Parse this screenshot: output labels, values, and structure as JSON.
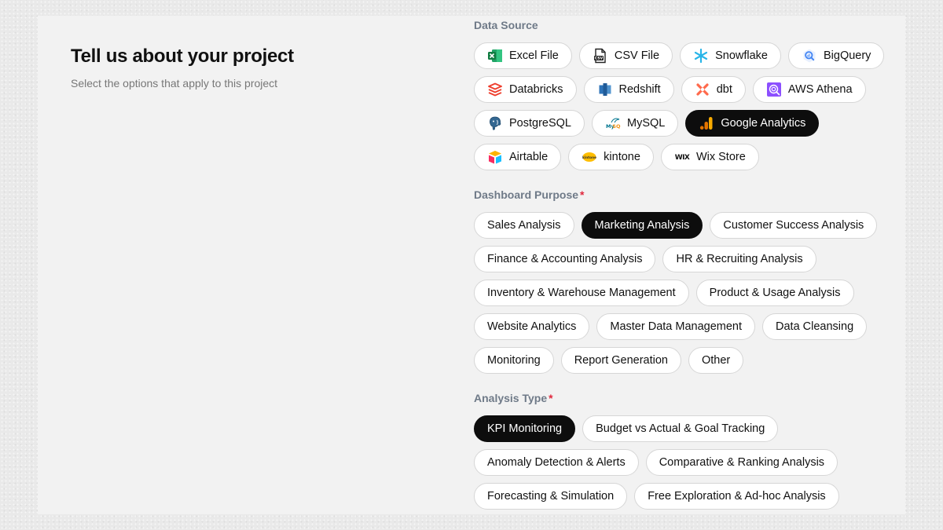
{
  "page": {
    "title": "Tell us about your project",
    "subtitle": "Select the options that apply to this project"
  },
  "sections": {
    "data_source": {
      "label": "Data Source",
      "options": [
        {
          "label": "Excel File",
          "icon": "excel-icon",
          "selected": false
        },
        {
          "label": "CSV File",
          "icon": "csv-file-icon",
          "selected": false
        },
        {
          "label": "Snowflake",
          "icon": "snowflake-icon",
          "selected": false
        },
        {
          "label": "BigQuery",
          "icon": "bigquery-icon",
          "selected": false
        },
        {
          "label": "Databricks",
          "icon": "databricks-icon",
          "selected": false
        },
        {
          "label": "Redshift",
          "icon": "redshift-icon",
          "selected": false
        },
        {
          "label": "dbt",
          "icon": "dbt-icon",
          "selected": false
        },
        {
          "label": "AWS Athena",
          "icon": "aws-athena-icon",
          "selected": false
        },
        {
          "label": "PostgreSQL",
          "icon": "postgresql-icon",
          "selected": false
        },
        {
          "label": "MySQL",
          "icon": "mysql-icon",
          "selected": false
        },
        {
          "label": "Google Analytics",
          "icon": "google-analytics-icon",
          "selected": true
        },
        {
          "label": "Airtable",
          "icon": "airtable-icon",
          "selected": false
        },
        {
          "label": "kintone",
          "icon": "kintone-icon",
          "selected": false
        },
        {
          "label": "Wix Store",
          "icon": "wix-icon",
          "selected": false
        }
      ]
    },
    "dashboard_purpose": {
      "label": "Dashboard Purpose",
      "required_mark": "*",
      "options": [
        {
          "label": "Sales Analysis",
          "selected": false
        },
        {
          "label": "Marketing Analysis",
          "selected": true
        },
        {
          "label": "Customer Success Analysis",
          "selected": false
        },
        {
          "label": "Finance & Accounting Analysis",
          "selected": false
        },
        {
          "label": "HR & Recruiting Analysis",
          "selected": false
        },
        {
          "label": "Inventory & Warehouse Management",
          "selected": false
        },
        {
          "label": "Product & Usage Analysis",
          "selected": false
        },
        {
          "label": "Website Analytics",
          "selected": false
        },
        {
          "label": "Master Data Management",
          "selected": false
        },
        {
          "label": "Data Cleansing",
          "selected": false
        },
        {
          "label": "Monitoring",
          "selected": false
        },
        {
          "label": "Report Generation",
          "selected": false
        },
        {
          "label": "Other",
          "selected": false
        }
      ]
    },
    "analysis_type": {
      "label": "Analysis Type",
      "required_mark": "*",
      "options": [
        {
          "label": "KPI Monitoring",
          "selected": true
        },
        {
          "label": "Budget vs Actual & Goal Tracking",
          "selected": false
        },
        {
          "label": "Anomaly Detection & Alerts",
          "selected": false
        },
        {
          "label": "Comparative & Ranking Analysis",
          "selected": false
        },
        {
          "label": "Forecasting & Simulation",
          "selected": false
        },
        {
          "label": "Free Exploration & Ad-hoc Analysis",
          "selected": false
        }
      ]
    }
  }
}
